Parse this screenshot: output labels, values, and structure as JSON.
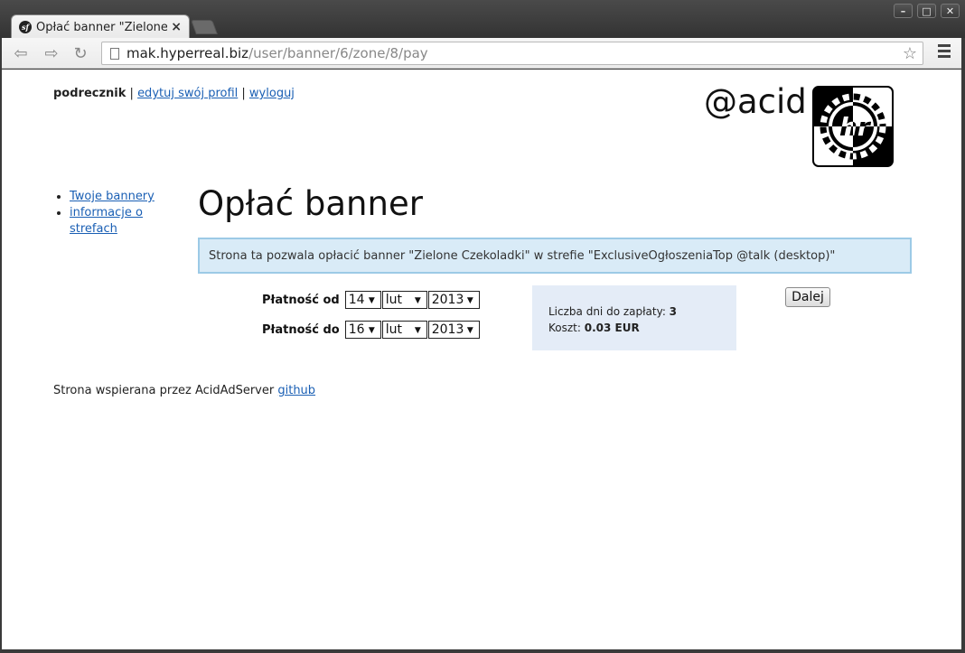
{
  "browser": {
    "tab_title": "Opłać banner \"Zielone C",
    "tab_close": "×",
    "url_host": "mak.hyperreal.biz",
    "url_path": "/user/banner/6/zone/8/pay",
    "window_buttons": [
      "–",
      "□",
      "✕"
    ]
  },
  "header": {
    "user": "podrecznik",
    "sep": " | ",
    "edit_profile": "edytuj swój profil",
    "logout": "wyloguj",
    "brand": "@acid"
  },
  "sidebar": {
    "items": [
      {
        "label": "Twoje bannery"
      },
      {
        "label": "informacje o strefach"
      }
    ]
  },
  "main": {
    "title": "Opłać banner",
    "info": "Strona ta pozwala opłacić banner \"Zielone Czekoladki\" w strefie \"ExclusiveOgłoszeniaTop @talk (desktop)\"",
    "from": {
      "label": "Płatność od",
      "day": "14",
      "month": "lut",
      "year": "2013"
    },
    "to": {
      "label": "Płatność do",
      "day": "16",
      "month": "lut",
      "year": "2013"
    },
    "days_label": "Liczba dni do zapłaty: ",
    "days_value": "3",
    "cost_label": "Koszt: ",
    "cost_value": "0.03 EUR",
    "next_button": "Dalej"
  },
  "footer": {
    "text": "Strona wspierana przez AcidAdServer ",
    "link": "github"
  }
}
